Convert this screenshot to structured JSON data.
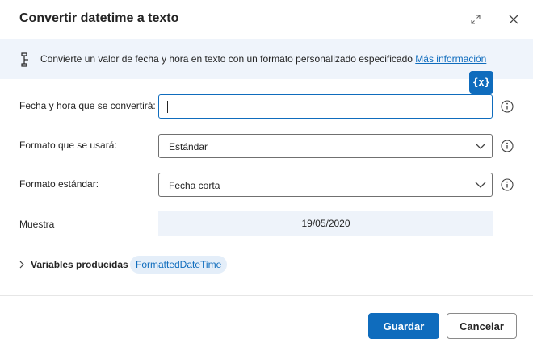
{
  "dialog": {
    "title": "Convertir datetime a texto",
    "icons": {
      "expand": "expand-icon",
      "close": "close-icon"
    }
  },
  "banner": {
    "text": "Convierte un valor de fecha y hora en texto con un formato personalizado especificado",
    "link": "Más información",
    "icon": "datetime-action-icon"
  },
  "variable_picker": {
    "label": "{x}"
  },
  "fields": {
    "datetime": {
      "label": "Fecha y hora que se convertirá:",
      "value": ""
    },
    "format": {
      "label": "Formato que se usará:",
      "value": "Estándar"
    },
    "standard_format": {
      "label": "Formato estándar:",
      "value": "Fecha corta"
    },
    "sample": {
      "label": "Muestra",
      "value": "19/05/2020"
    }
  },
  "variables": {
    "label": "Variables producidas",
    "items": [
      "FormattedDateTime"
    ]
  },
  "footer": {
    "save": "Guardar",
    "cancel": "Cancelar"
  },
  "colors": {
    "accent": "#0f6cbd",
    "banner_bg": "#eff4fb",
    "pill_bg": "#e4eef9"
  }
}
